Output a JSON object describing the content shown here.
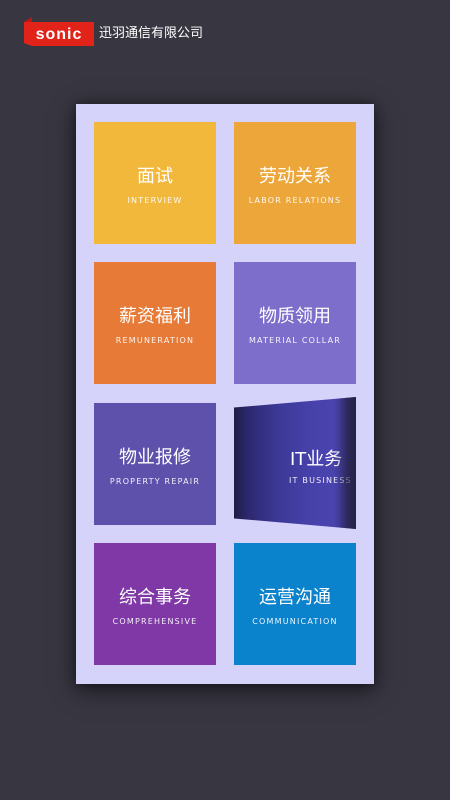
{
  "header": {
    "logo_text": "sonic",
    "company_name": "迅羽通信有限公司"
  },
  "colors": {
    "background": "#383641",
    "panel": "#d6d3fb",
    "logo_red": "#e2231a"
  },
  "tiles": [
    {
      "cn": "面试",
      "en": "INTERVIEW",
      "color": "#f2b83c"
    },
    {
      "cn": "劳动关系",
      "en": "LABOR RELATIONS",
      "color": "#eca63a"
    },
    {
      "cn": "薪资福利",
      "en": "REMUNERATION",
      "color": "#e67a36"
    },
    {
      "cn": "物质领用",
      "en": "MATERIAL COLLAR",
      "color": "#7e6ecb"
    },
    {
      "cn": "物业报修",
      "en": "PROPERTY REPAIR",
      "color": "#5d51ab"
    },
    {
      "cn": "IT业务",
      "en": "IT BUSINESS",
      "color": "#4a43ae"
    },
    {
      "cn": "综合事务",
      "en": "COMPREHENSIVE",
      "color": "#7f38a6"
    },
    {
      "cn": "运营沟通",
      "en": "COMMUNICATION",
      "color": "#0b82cc"
    }
  ]
}
